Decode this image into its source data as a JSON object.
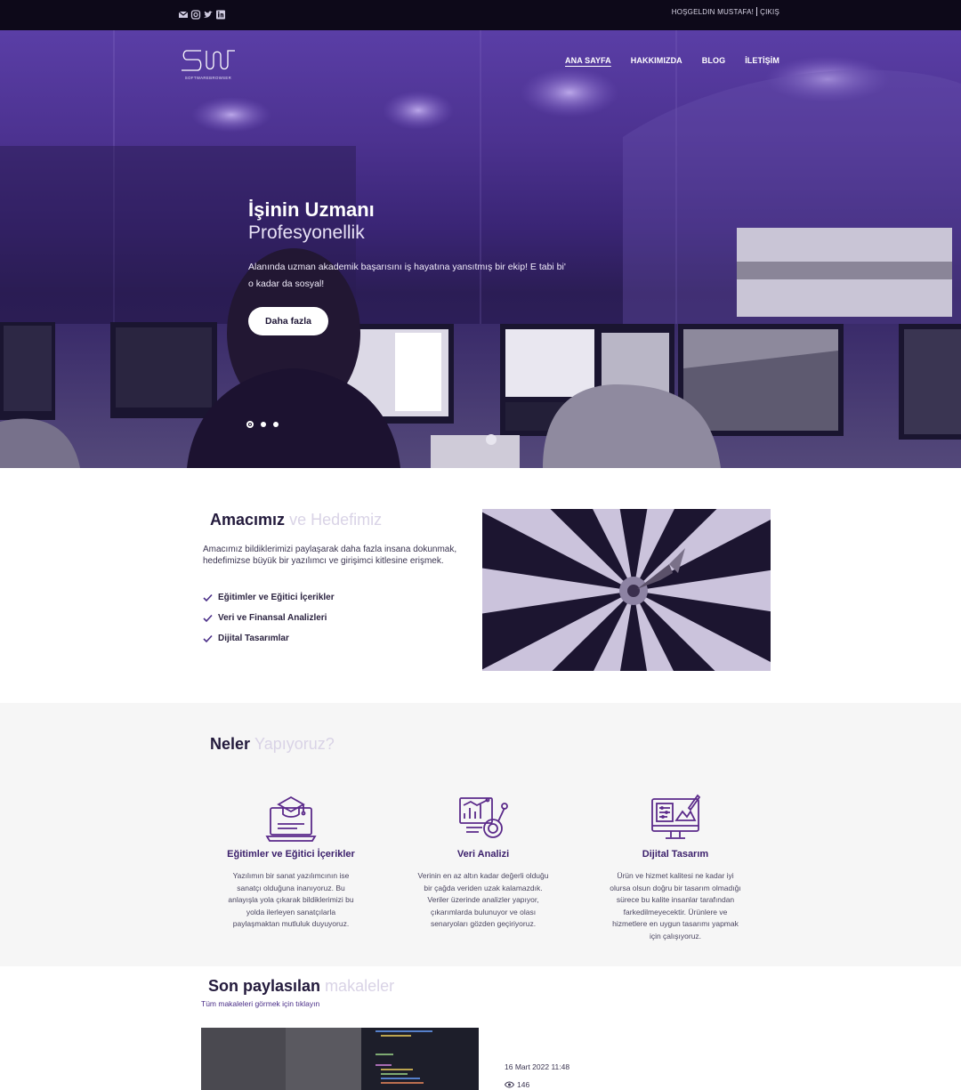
{
  "topbar": {
    "social_icons": [
      "mail-icon",
      "instagram-icon",
      "twitter-icon",
      "linkedin-icon"
    ],
    "welcome_text": "HOŞGELDIN MUSTAFA!",
    "logout_label": "ÇIKIŞ"
  },
  "logo": {
    "mark": "SW",
    "subtitle": "SOFTWAREBROWSER"
  },
  "nav": {
    "items": [
      {
        "label": "ANA SAYFA",
        "active": true
      },
      {
        "label": "HAKKIMIZDA",
        "active": false
      },
      {
        "label": "BLOG",
        "active": false
      },
      {
        "label": "İLETİŞİM",
        "active": false
      }
    ]
  },
  "hero": {
    "title": "İşinin Uzmanı",
    "subtitle": "Profesyonellik",
    "text_line1": "Alanında uzman akademik başarısını iş hayatına yansıtmış bir ekip! E tabi bi'",
    "text_line2": "o kadar da sosyal!",
    "button_label": "Daha fazla",
    "slide_count": 3,
    "active_slide": 1
  },
  "goals": {
    "title_bold": "Amacımız",
    "title_light": "ve Hedefimiz",
    "description": "Amacımız bildiklerimizi paylaşarak daha fazla insana dokunmak, hedefimizse büyük bir yazılımcı ve girişimci kitlesine erişmek.",
    "items": [
      "Eğitimler ve Eğitici İçerikler",
      "Veri ve Finansal Analizleri",
      "Dijital Tasarımlar"
    ]
  },
  "services": {
    "title_bold": "Neler",
    "title_light": "Yapıyoruz?",
    "items": [
      {
        "icon": "graduation-laptop-icon",
        "title": "Eğitimler ve Eğitici İçerikler",
        "text": "Yazılımın bir sanat yazılımcının ise sanatçı olduğuna inanıyoruz. Bu anlayışla yola çıkarak bildiklerimizi bu yolda ilerleyen sanatçılarla paylaşmaktan mutluluk duyuyoruz."
      },
      {
        "icon": "data-analysis-icon",
        "title": "Veri Analizi",
        "text": "Verinin en az altın kadar değerli olduğu bir çağda veriden uzak kalamazdık. Veriler üzerinde analizler yapıyor, çıkarımlarda bulunuyor ve olası senaryoları gözden geçiriyoruz."
      },
      {
        "icon": "digital-design-icon",
        "title": "Dijital Tasarım",
        "text": "Ürün ve hizmet kalitesi ne kadar iyi olursa olsun doğru bir tasarım olmadığı sürece bu kalite insanlar tarafından farkedilmeyecektir. Ürünlere ve hizmetlere en uygun tasarımı yapmak için çalışıyoruz."
      }
    ]
  },
  "articles": {
    "title_bold": "Son paylasılan",
    "title_light": "makaleler",
    "all_link": "Tüm makaleleri görmek için tıklayın",
    "latest": {
      "date": "16 Mart 2022 11:48",
      "views": "146"
    }
  },
  "colors": {
    "topbar_bg": "#0d0919",
    "accent": "#4a2e88",
    "icon_purple": "#5b2a8a",
    "section_gray": "#f6f6f6"
  }
}
